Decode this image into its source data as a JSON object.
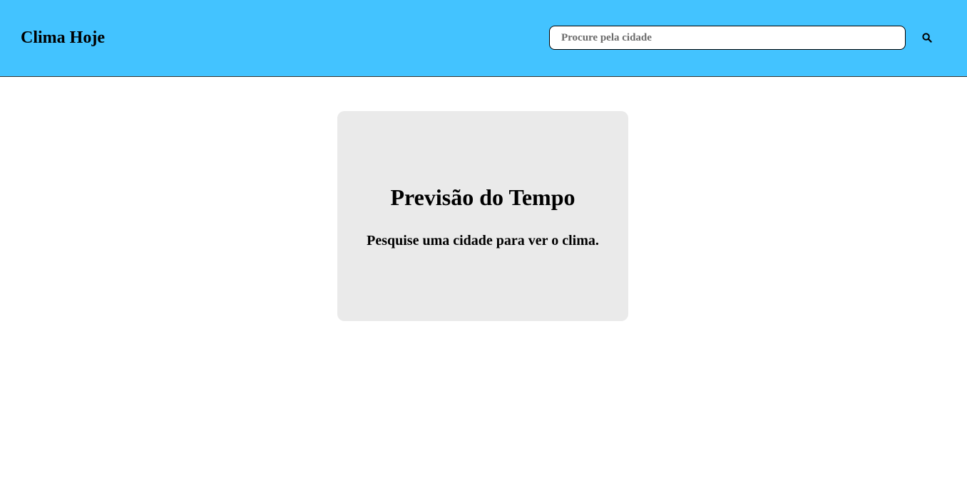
{
  "header": {
    "brand": "Clima Hoje",
    "search": {
      "placeholder": "Procure pela cidade",
      "value": ""
    },
    "search_button_icon": "search-icon"
  },
  "main": {
    "card": {
      "title": "Previsão do Tempo",
      "message": "Pesquise uma cidade para ver o clima."
    }
  },
  "colors": {
    "header_bg": "#43c3ff",
    "card_bg": "#eaeaea",
    "text": "#000000"
  }
}
